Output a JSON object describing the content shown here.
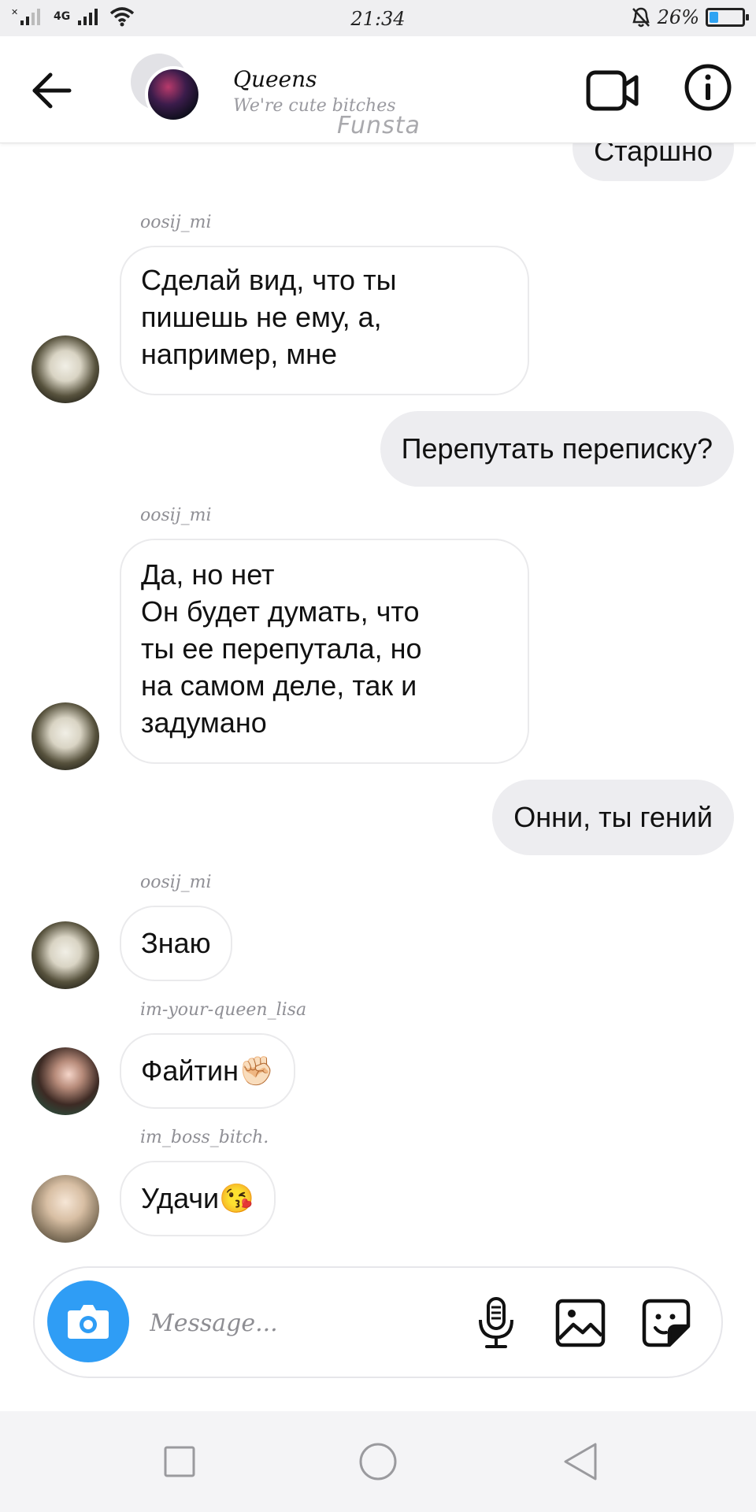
{
  "status_bar": {
    "time": "21:34",
    "network": "4G",
    "battery_text": "26%",
    "battery_level": 0.26
  },
  "header": {
    "title": "Queens",
    "subtitle": "We're cute bitches",
    "watermark": "Funsta"
  },
  "messages": [
    {
      "type": "out",
      "text": "Старшно"
    },
    {
      "type": "sender",
      "text": "oosij_mi"
    },
    {
      "type": "in",
      "lines": [
        "Сделай вид, что ты",
        "пишешь не ему, а,",
        "например, мне"
      ]
    },
    {
      "type": "out",
      "text": "Перепутать переписку?"
    },
    {
      "type": "sender",
      "text": "oosij_mi"
    },
    {
      "type": "in",
      "lines": [
        "Да, но нет",
        "Он будет думать, что",
        "ты ее перепутала, но",
        "на самом деле, так и",
        "задумано"
      ]
    },
    {
      "type": "out",
      "text": "Онни, ты гений"
    },
    {
      "type": "sender",
      "text": "oosij_mi"
    },
    {
      "type": "in",
      "text": "Знаю"
    },
    {
      "type": "sender",
      "text": "im-your-queen_lisa"
    },
    {
      "type": "in",
      "text": "Файтин",
      "emoji": "✊🏻"
    },
    {
      "type": "sender",
      "text": "im_boss_bitch."
    },
    {
      "type": "in",
      "text": "Удачи",
      "emoji": "😘"
    }
  ],
  "composer": {
    "placeholder": "Message..."
  },
  "icons": {
    "back": "arrow-left-icon",
    "video": "video-camera-icon",
    "info": "info-icon",
    "camera": "camera-icon",
    "mic": "microphone-icon",
    "gallery": "image-icon",
    "sticker": "sticker-icon"
  },
  "colors": {
    "accent": "#2f9df5",
    "outgoing_bubble": "#ededf0",
    "sender_name": "#8f8f95"
  }
}
